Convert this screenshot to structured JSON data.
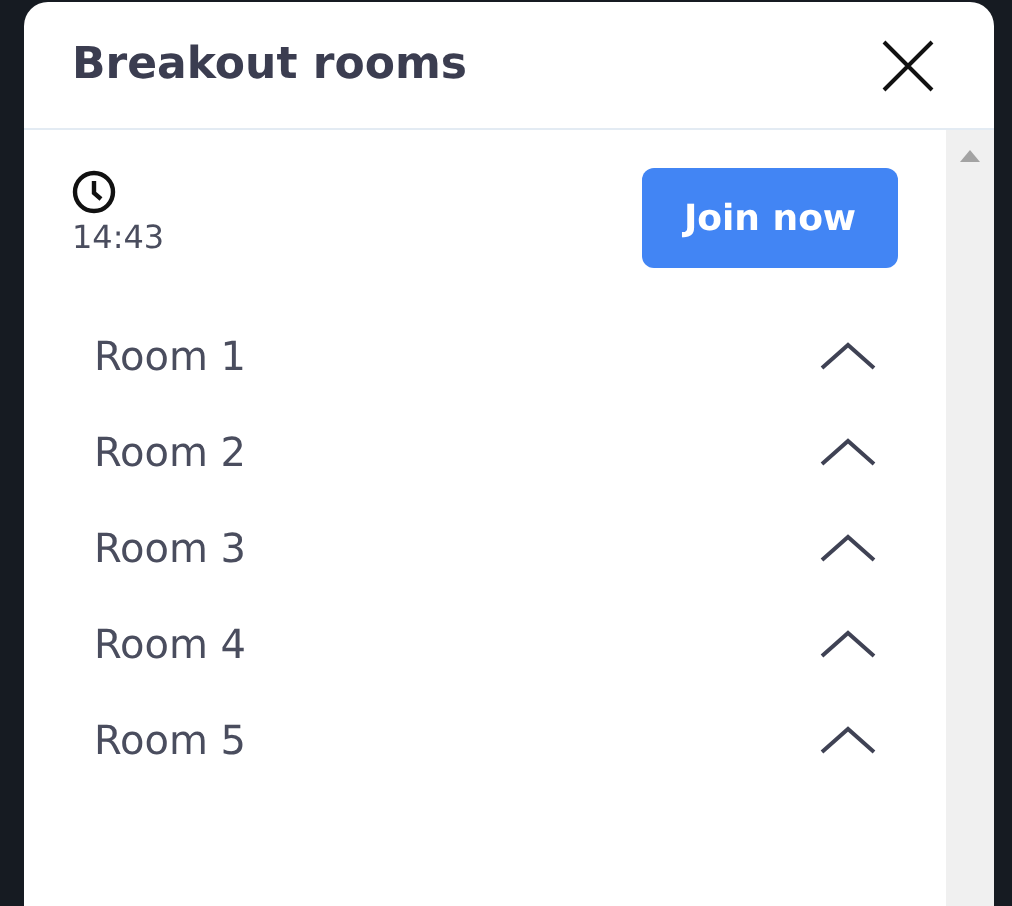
{
  "panel": {
    "title": "Breakout rooms"
  },
  "timer": {
    "time": "14:43"
  },
  "join_button": {
    "label": "Join now"
  },
  "rooms": [
    {
      "name": "Room 1"
    },
    {
      "name": "Room 2"
    },
    {
      "name": "Room 3"
    },
    {
      "name": "Room 4"
    },
    {
      "name": "Room 5"
    }
  ]
}
